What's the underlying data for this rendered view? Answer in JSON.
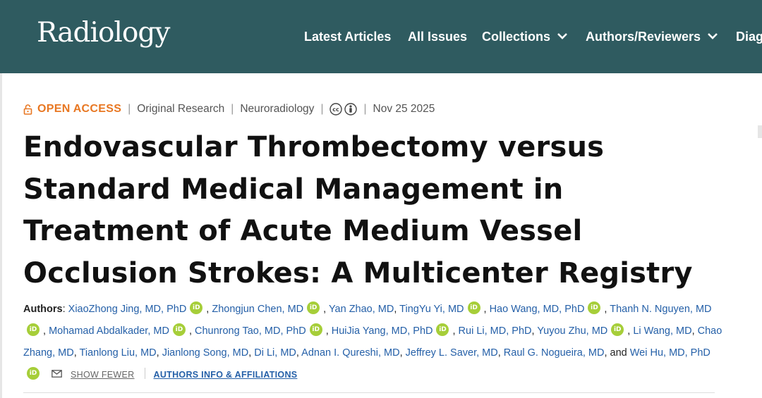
{
  "header": {
    "logo": "Radiology",
    "nav": [
      "Latest Articles",
      "All Issues",
      "Collections",
      "Authors/Reviewers",
      "Diag"
    ],
    "dropdown_items": [
      "Collections",
      "Authors/Reviewers"
    ]
  },
  "meta": {
    "access": "OPEN ACCESS",
    "type": "Original Research",
    "section": "Neuroradiology",
    "date": "Nov 25 2025"
  },
  "title": "Endovascular Thrombectomy versus Standard Medical Management in Treatment of Acute Medium Vessel Occlusion Strokes: A Multicenter Registry",
  "authors": {
    "label": "Authors",
    "list": [
      "XiaoZhong Jing, MD, PhD",
      "Zhongjun Chen, MD",
      "Yan Zhao, MD",
      "TingYu Yi, MD",
      "Hao Wang, MD, PhD",
      "Thanh N. Nguyen, MD",
      "Mohamad Abdalkader, MD",
      "Chunrong Tao, MD, PhD",
      "HuiJia Yang, MD, PhD",
      "Rui Li, MD, PhD",
      "Yuyou Zhu, MD",
      "Li Wang, MD",
      "Chao Zhang, MD",
      "Tianlong Liu, MD",
      "Jianlong Song, MD",
      "Di Li, MD",
      "Adnan I. Qureshi, MD",
      "Jeffrey L. Saver, MD",
      "Raul G. Nogueira, MD",
      "Wei Hu, MD, PhD"
    ],
    "conj": "and",
    "orcid_badge": "iD",
    "show_fewer": "SHOW FEWER",
    "info_link": "AUTHORS INFO & AFFILIATIONS"
  },
  "colors": {
    "header_bg": "#2f5b60",
    "open_access": "#e87722",
    "link": "#2560a8",
    "orcid": "#a6ce39"
  },
  "icons": [
    "lock-icon",
    "chevron-down-icon",
    "creative-commons-icon",
    "attribution-icon",
    "orcid-icon",
    "mail-icon"
  ]
}
